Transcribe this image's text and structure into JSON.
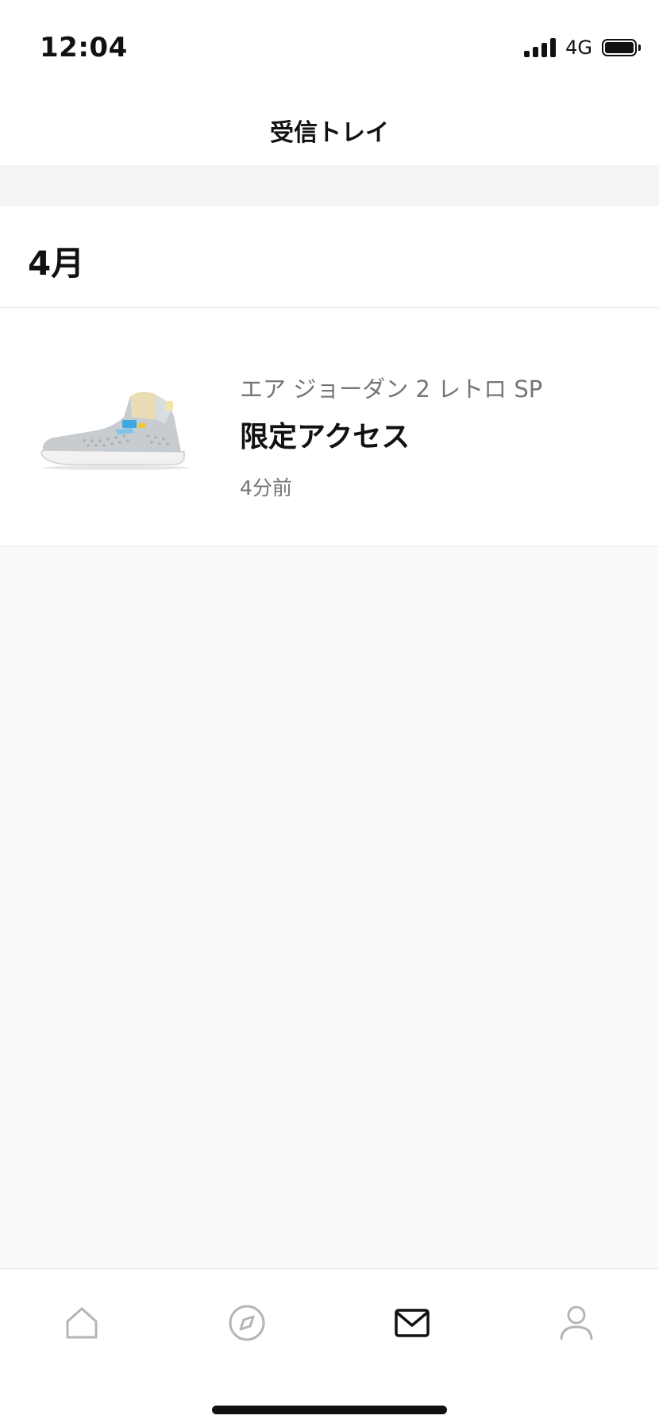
{
  "status_bar": {
    "time": "12:04",
    "network": "4G",
    "signal_icon": "cellular-signal-icon",
    "battery_icon": "battery-icon"
  },
  "header": {
    "title": "受信トレイ"
  },
  "sections": [
    {
      "title": "4月",
      "items": [
        {
          "product": "エア ジョーダン 2 レトロ SP",
          "title": "限定アクセス",
          "time": "4分前",
          "thumbnail_icon": "sneaker-image"
        }
      ]
    }
  ],
  "tab_bar": {
    "tabs": [
      {
        "icon": "home-icon",
        "active": false
      },
      {
        "icon": "compass-icon",
        "active": false
      },
      {
        "icon": "mail-icon",
        "active": true
      },
      {
        "icon": "profile-icon",
        "active": false
      }
    ],
    "colors": {
      "active": "#111111",
      "inactive": "#b5b5b5"
    }
  }
}
